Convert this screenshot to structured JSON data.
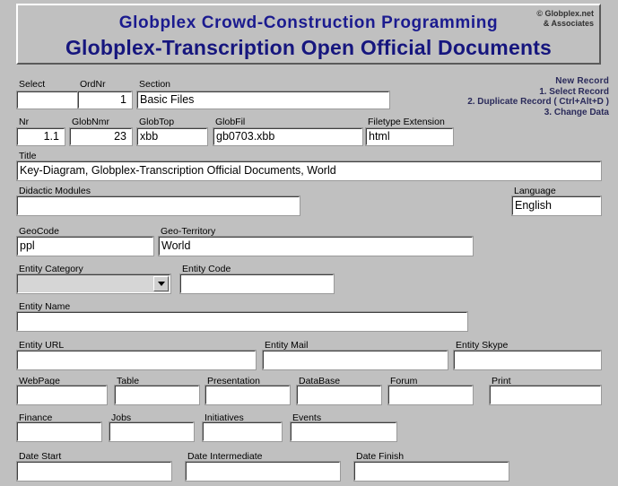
{
  "banner": {
    "line1": "Globplex Crowd-Construction Programming",
    "line2": "Globplex-Transcription Open Official Documents",
    "copyright_line1": "© Globplex.net",
    "copyright_line2": "& Associates",
    "title_color": "#1b1b8f"
  },
  "new_record": {
    "title": "New Record",
    "step1": "1. Select Record",
    "step2": "2. Duplicate Record ( Ctrl+Alt+D )",
    "step3": "3. Change Data"
  },
  "fields": {
    "select": {
      "label": "Select",
      "value": "",
      "placeholder": ""
    },
    "ordnr": {
      "label": "OrdNr",
      "value": "1",
      "placeholder": ""
    },
    "section": {
      "label": "Section",
      "value": "Basic Files",
      "placeholder": ""
    },
    "nr": {
      "label": "Nr",
      "value": "1.1",
      "placeholder": ""
    },
    "globnmr": {
      "label": "GlobNmr",
      "value": "23",
      "placeholder": ""
    },
    "globtop": {
      "label": "GlobTop",
      "value": "xbb",
      "placeholder": ""
    },
    "globfil": {
      "label": "GlobFil",
      "value": "gb0703.xbb",
      "placeholder": ""
    },
    "filetype_extension": {
      "label": "Filetype Extension",
      "value": "html",
      "placeholder": ""
    },
    "title": {
      "label": "Title",
      "value": "Key-Diagram, Globplex-Transcription Official Documents, World",
      "placeholder": ""
    },
    "didactic_modules": {
      "label": "Didactic Modules",
      "value": "",
      "placeholder": ""
    },
    "language": {
      "label": "Language",
      "value": "English",
      "placeholder": ""
    },
    "geocode": {
      "label": "GeoCode",
      "value": "ppl",
      "placeholder": ""
    },
    "geo_territory": {
      "label": "Geo-Territory",
      "value": "World",
      "placeholder": ""
    },
    "entity_category": {
      "label": "Entity Category",
      "value": "",
      "placeholder": ""
    },
    "entity_code": {
      "label": "Entity Code",
      "value": "",
      "placeholder": ""
    },
    "entity_name": {
      "label": "Entity Name",
      "value": "",
      "placeholder": ""
    },
    "entity_url": {
      "label": "Entity URL",
      "value": "",
      "placeholder": ""
    },
    "entity_mail": {
      "label": "Entity Mail",
      "value": "",
      "placeholder": ""
    },
    "entity_skype": {
      "label": "Entity Skype",
      "value": "",
      "placeholder": ""
    },
    "webpage": {
      "label": "WebPage",
      "value": "",
      "placeholder": ""
    },
    "table": {
      "label": "Table",
      "value": "",
      "placeholder": ""
    },
    "presentation": {
      "label": "Presentation",
      "value": "",
      "placeholder": ""
    },
    "database": {
      "label": "DataBase",
      "value": "",
      "placeholder": ""
    },
    "forum": {
      "label": "Forum",
      "value": "",
      "placeholder": ""
    },
    "print": {
      "label": "Print",
      "value": "",
      "placeholder": ""
    },
    "finance": {
      "label": "Finance",
      "value": "",
      "placeholder": ""
    },
    "jobs": {
      "label": "Jobs",
      "value": "",
      "placeholder": ""
    },
    "initiatives": {
      "label": "Initiatives",
      "value": "",
      "placeholder": ""
    },
    "events": {
      "label": "Events",
      "value": "",
      "placeholder": ""
    },
    "date_start": {
      "label": "Date Start",
      "value": "",
      "placeholder": ""
    },
    "date_intermediate": {
      "label": "Date Intermediate",
      "value": "",
      "placeholder": ""
    },
    "date_finish": {
      "label": "Date Finish",
      "value": "",
      "placeholder": ""
    }
  },
  "icons": {
    "dropdown": "chevron-down-icon"
  }
}
